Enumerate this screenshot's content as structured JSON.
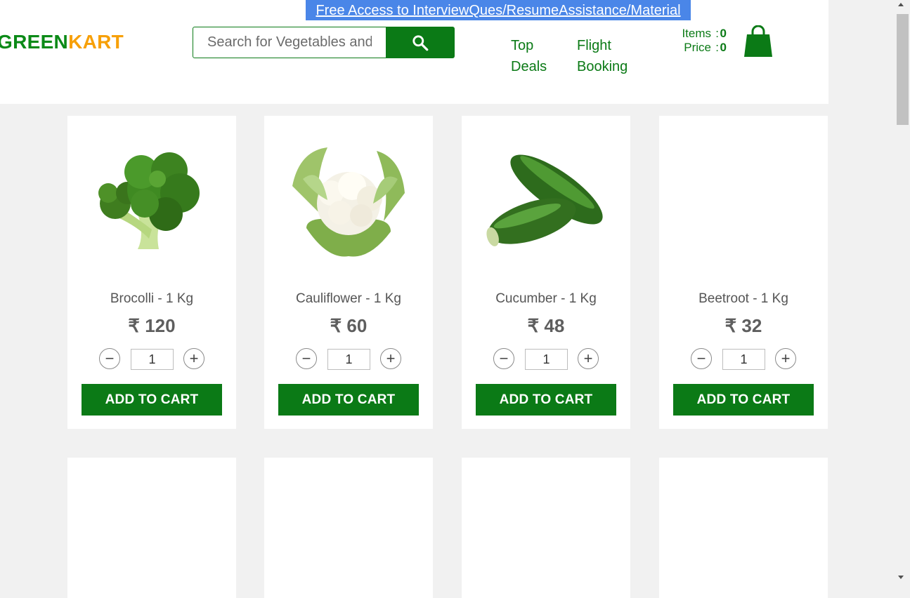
{
  "promo": {
    "text": "Free Access to InterviewQues/ResumeAssistance/Material"
  },
  "brand": {
    "part1": "GREEN",
    "part2": "KART"
  },
  "search": {
    "placeholder": "Search for Vegetables and Fruits",
    "button_icon": "search-icon"
  },
  "nav": {
    "top_deals": [
      "Top",
      "Deals"
    ],
    "flight_booking": [
      "Flight",
      "Booking"
    ]
  },
  "cart": {
    "items_label": "Items",
    "items_value": "0",
    "price_label": "Price",
    "price_value": "0",
    "separator": ":",
    "icon": "shopping-bag-icon"
  },
  "products": [
    {
      "name": "Brocolli - 1 Kg",
      "price": "₹ 120",
      "qty": "1",
      "button": "ADD TO CART",
      "image": "broccoli"
    },
    {
      "name": "Cauliflower - 1 Kg",
      "price": "₹ 60",
      "qty": "1",
      "button": "ADD TO CART",
      "image": "cauliflower"
    },
    {
      "name": "Cucumber - 1 Kg",
      "price": "₹ 48",
      "qty": "1",
      "button": "ADD TO CART",
      "image": "cucumber"
    },
    {
      "name": "Beetroot - 1 Kg",
      "price": "₹ 32",
      "qty": "1",
      "button": "ADD TO CART",
      "image": ""
    }
  ],
  "stepper": {
    "minus": "−",
    "plus": "+"
  },
  "colors": {
    "brand_green": "#0b7a16",
    "brand_orange": "#f7a008",
    "promo_bg": "#4a86e8"
  }
}
